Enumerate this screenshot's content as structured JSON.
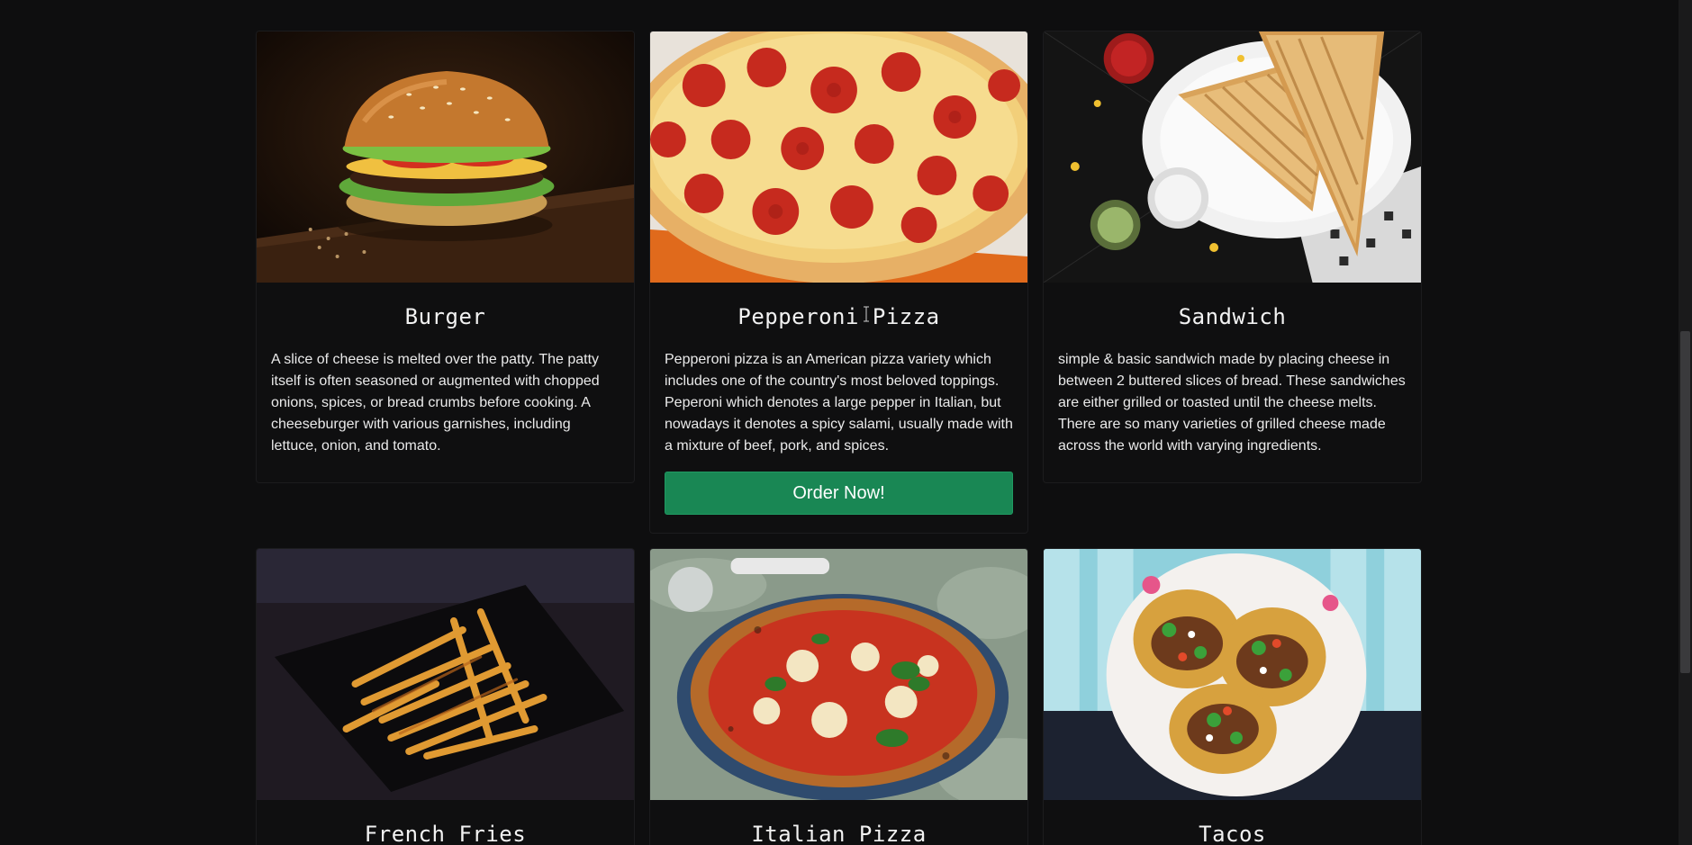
{
  "cards": [
    {
      "title": "Burger",
      "description": "A slice of cheese is melted over the patty. The patty itself is often seasoned or augmented with chopped onions, spices, or bread crumbs before cooking. A cheeseburger with various garnishes, including lettuce, onion, and tomato.",
      "image": "burger-photo"
    },
    {
      "title": "Pepperoni Pizza",
      "description": "Pepperoni pizza is an American pizza variety which includes one of the country's most beloved toppings. Peperoni which denotes a large pepper in Italian, but nowadays it denotes a spicy salami, usually made with a mixture of beef, pork, and spices.",
      "image": "pepperoni-pizza-photo",
      "button": "Order Now!"
    },
    {
      "title": "Sandwich",
      "description": "simple & basic sandwich made by placing cheese in between 2 buttered slices of bread. These sandwiches are either grilled or toasted until the cheese melts. There are so many varieties of grilled cheese made across the world with varying ingredients.",
      "image": "sandwich-photo"
    },
    {
      "title": "French Fries",
      "image": "french-fries-photo"
    },
    {
      "title": "Italian Pizza",
      "image": "italian-pizza-photo"
    },
    {
      "title": "Tacos",
      "image": "tacos-photo"
    }
  ],
  "colors": {
    "background": "#0e0e0f",
    "button": "#198754",
    "text": "#eaeaea"
  }
}
